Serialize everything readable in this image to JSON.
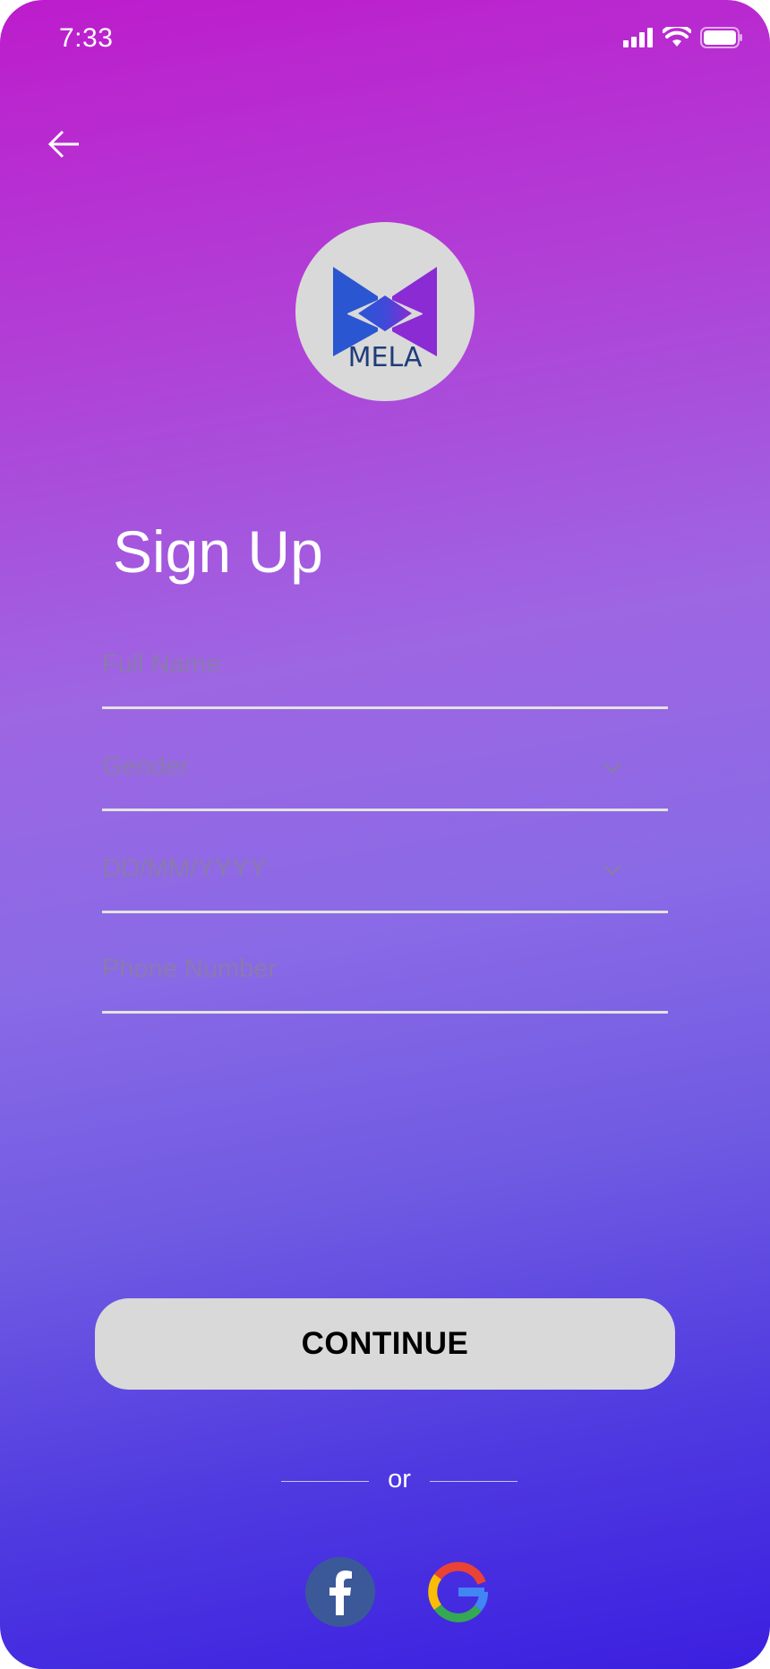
{
  "status_bar": {
    "time": "7:33"
  },
  "logo": {
    "text": "MELA"
  },
  "title": "Sign Up",
  "form": {
    "full_name": {
      "placeholder": "Full Name",
      "value": ""
    },
    "gender": {
      "placeholder": "Gender",
      "value": ""
    },
    "date_of_birth": {
      "placeholder": "DD/MM/YYYY",
      "value": ""
    },
    "phone_number": {
      "placeholder": "Phone Number",
      "value": ""
    }
  },
  "continue_label": "CONTINUE",
  "divider_text": "or",
  "icons": {
    "back": "arrow-left-icon",
    "facebook": "facebook-icon",
    "google": "google-icon",
    "signal": "cellular-signal-icon",
    "wifi": "wifi-icon",
    "battery": "battery-icon"
  },
  "colors": {
    "gradient_top": "#bd1ccc",
    "gradient_bottom": "#3b1fe0",
    "button_bg": "#d9d9d9",
    "facebook": "#3b5998"
  }
}
